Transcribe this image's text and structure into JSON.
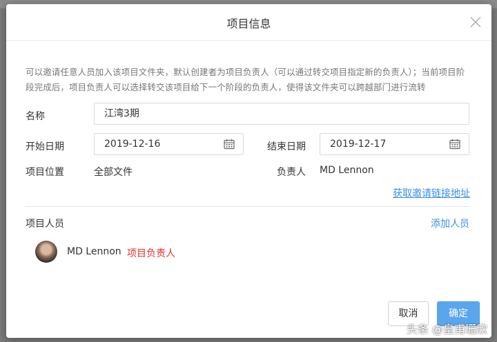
{
  "dialog": {
    "title": "项目信息",
    "description": "可以邀请任意人员加入该项目文件夹，默认创建者为项目负责人（可以通过转交项目指定新的负责人）；当前项目阶段完成后，项目负责人可以选择转交该项目给下一个阶段的负责人，使得该文件夹可以跨越部门进行流转"
  },
  "form": {
    "name_label": "名称",
    "name_value": "江湾3期",
    "start_label": "开始日期",
    "start_value": "2019-12-16",
    "end_label": "结束日期",
    "end_value": "2019-12-17",
    "location_label": "项目位置",
    "location_value": "全部文件",
    "owner_label": "负责人",
    "owner_value": "MD Lennon",
    "invite_link": "获取邀请链接地址"
  },
  "members": {
    "label": "项目人员",
    "add_link": "添加人员",
    "items": [
      {
        "name": "MD Lennon",
        "role": "项目负责人"
      }
    ]
  },
  "footer": {
    "cancel_label": "取消",
    "ok_label": "确定"
  },
  "watermark": "头条 @皇甫珊欣",
  "colors": {
    "accent": "#3a8ee6",
    "primary_button": "#5aa6ec",
    "role_red": "#e0312d"
  },
  "icons": [
    "close-icon",
    "calendar-icon",
    "avatar"
  ]
}
